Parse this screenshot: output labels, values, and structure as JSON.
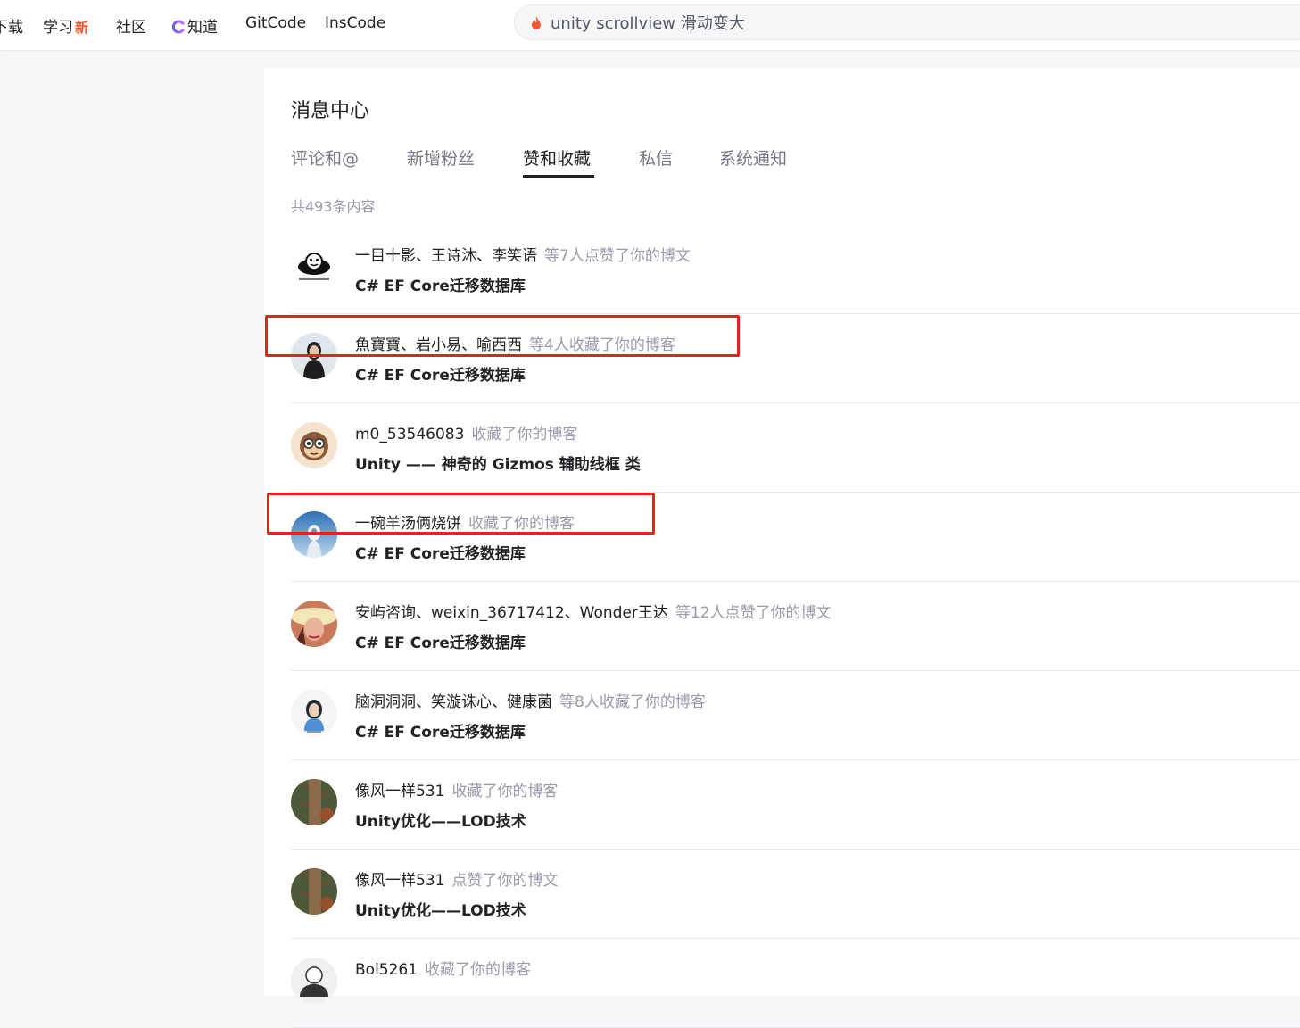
{
  "nav": {
    "items": [
      {
        "label": "下载"
      },
      {
        "label": "学习",
        "badge": "新"
      },
      {
        "label": "社区"
      },
      {
        "label": "知道"
      },
      {
        "label": "GitCode"
      },
      {
        "label": "InsCode"
      }
    ],
    "search_value": "unity scrollview 滑动变大",
    "accent": "#fc5531"
  },
  "panel": {
    "title": "消息中心",
    "tabs": [
      {
        "label": "评论和@"
      },
      {
        "label": "新增粉丝"
      },
      {
        "label": "赞和收藏",
        "active": true
      },
      {
        "label": "私信"
      },
      {
        "label": "系统通知"
      }
    ],
    "count_text": "共493条内容"
  },
  "list": [
    {
      "names": "一目十影、王诗沐、李笑语",
      "action": "等7人点赞了你的博文",
      "title": "C# EF Core迁移数据库",
      "avatar": "meme-face-icon"
    },
    {
      "names": "魚寶寶、岩小易、喻西西",
      "action": "等4人收藏了你的博客",
      "title": "C# EF Core迁移数据库",
      "avatar": "woman-portrait-icon"
    },
    {
      "names": "m0_53546083",
      "action": "收藏了你的博客",
      "title": "Unity —— 神奇的 Gizmos 辅助线框 类",
      "avatar": "monkey-icon"
    },
    {
      "names": "一碗羊汤俩烧饼",
      "action": "收藏了你的博客",
      "title": "C# EF Core迁移数据库",
      "avatar": "anime-girl-icon"
    },
    {
      "names": "安屿咨询、weixin_36717412、Wonder王达",
      "action": "等12人点赞了你的博文",
      "title": "C# EF Core迁移数据库",
      "avatar": "hat-woman-icon"
    },
    {
      "names": "脑洞洞洞、笑漩诛心、健康菌",
      "action": "等8人收藏了你的博客",
      "title": "C# EF Core迁移数据库",
      "avatar": "girl-photo-icon"
    },
    {
      "names": "像风一样531",
      "action": "收藏了你的博客",
      "title": "Unity优化——LOD技术",
      "avatar": "tree-trunk-icon"
    },
    {
      "names": "像风一样531",
      "action": "点赞了你的博文",
      "title": "Unity优化——LOD技术",
      "avatar": "tree-trunk-icon"
    },
    {
      "names": "Bol5261",
      "action": "收藏了你的博客",
      "title": "",
      "avatar": "default-avatar-icon"
    }
  ],
  "highlight_color": "#e8211b"
}
